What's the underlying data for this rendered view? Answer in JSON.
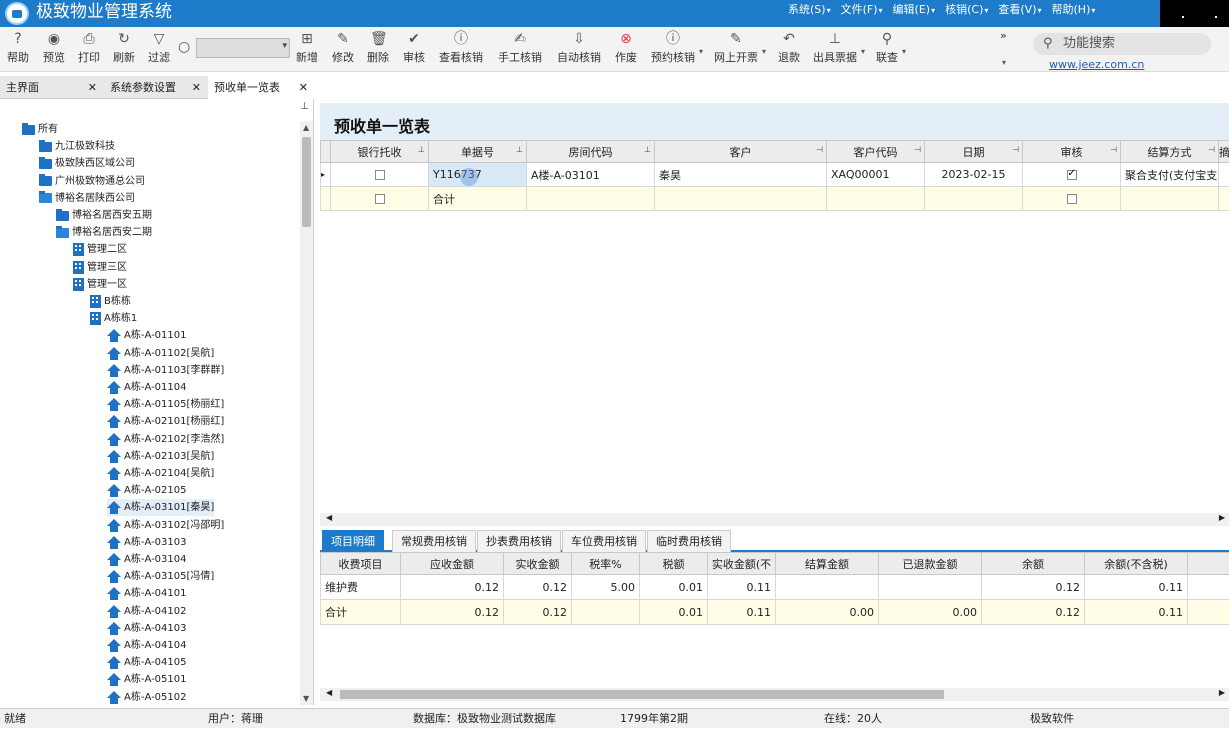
{
  "app": {
    "title": "极致物业管理系统",
    "menus": [
      "系统(S)",
      "文件(F)",
      "编辑(E)",
      "核销(C)",
      "查看(V)",
      "帮助(H)"
    ]
  },
  "toolbar": {
    "buttons": [
      "帮助",
      "预览",
      "打印",
      "刷新",
      "过滤",
      "新增",
      "修改",
      "删除",
      "审核",
      "查看核销",
      "手工核销",
      "自动核销",
      "作废",
      "预约核销",
      "网上开票",
      "退款",
      "出具票据",
      "联查"
    ],
    "filter_value": "",
    "func_search": "功能搜索",
    "website": "www.jeez.com.cn"
  },
  "tabs": [
    {
      "label": "主界面"
    },
    {
      "label": "系统参数设置"
    },
    {
      "label": "预收单一览表"
    }
  ],
  "tree": {
    "root": "所有",
    "nodes": [
      "九江极致科技",
      "极致陕西区域公司",
      "广州极致物通总公司",
      "博裕名居陕西公司",
      "博裕名居西安五期",
      "博裕名居西安二期",
      "管理二区",
      "管理三区",
      "管理一区",
      "B栋栋",
      "A栋栋1",
      "A栋-A-01101",
      "A栋-A-01102[吴航]",
      "A栋-A-01103[李群群]",
      "A栋-A-01104",
      "A栋-A-01105[杨丽红]",
      "A栋-A-02101[杨丽红]",
      "A栋-A-02102[李浩然]",
      "A栋-A-02103[吴航]",
      "A栋-A-02104[吴航]",
      "A栋-A-02105",
      "A栋-A-03101[秦昊]",
      "A栋-A-03102[冯邵明]",
      "A栋-A-03103",
      "A栋-A-03104",
      "A栋-A-03105[冯倩]",
      "A栋-A-04101",
      "A栋-A-04102",
      "A栋-A-04103",
      "A栋-A-04104",
      "A栋-A-04105",
      "A栋-A-05101",
      "A栋-A-05102"
    ]
  },
  "page": {
    "title": "预收单一览表",
    "columns": [
      "银行托收",
      "单据号",
      "房间代码",
      "客户",
      "客户代码",
      "日期",
      "审核",
      "结算方式",
      "摘"
    ],
    "row": {
      "bill_no": "Y116737",
      "room": "A楼-A-03101",
      "customer": "秦昊",
      "customer_code": "XAQ00001",
      "date": "2023-02-15",
      "settle": "聚合支付(支付宝支付)"
    },
    "sum_label": "合计"
  },
  "subtabs": [
    "项目明细",
    "常规费用核销",
    "抄表费用核销",
    "车位费用核销",
    "临时费用核销"
  ],
  "detail": {
    "columns": [
      "收费项目",
      "应收金额",
      "实收金额",
      "税率%",
      "税额",
      "实收金额(不",
      "结算金额",
      "已退款金额",
      "余额",
      "余额(不含税)"
    ],
    "row": [
      "维护费",
      "0.12",
      "0.12",
      "5.00",
      "0.01",
      "0.11",
      "",
      "",
      "0.12",
      "0.11"
    ],
    "sum": [
      "合计",
      "0.12",
      "0.12",
      "",
      "0.01",
      "0.11",
      "0.00",
      "0.00",
      "0.12",
      "0.11"
    ]
  },
  "status": {
    "ready": "就绪",
    "user": "用户：蒋珊",
    "db": "数据库：极致物业测试数据库",
    "period": "1799年第2期",
    "online": "在线：20人",
    "company": "极致软件"
  }
}
